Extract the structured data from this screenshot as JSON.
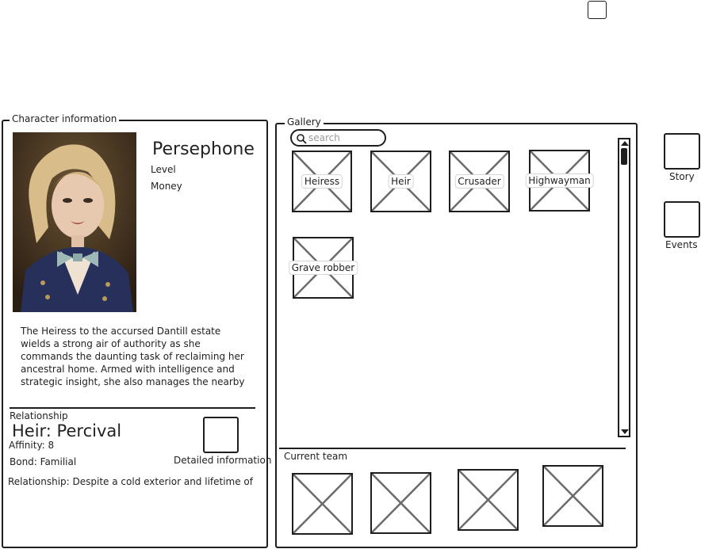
{
  "character_panel": {
    "legend": "Character information",
    "name": "Persephone",
    "level_label": "Level",
    "money_label": "Money",
    "description": "The Heiress to the accursed Dantill estate wields a strong air of authority as she commands the daunting task of reclaiming her ancestral home. Armed with intelligence and strategic insight, she also manages the nearby",
    "relationship_label": "Relationship",
    "heir_name": "Heir: Percival",
    "affinity": "Affinity: 8",
    "bond": "Bond: Familial",
    "detail_label": "Detailed information",
    "relationship_text": "Relationship: Despite a cold exterior and lifetime of"
  },
  "gallery": {
    "legend": "Gallery",
    "search_placeholder": "search",
    "items": [
      "Heiress",
      "Heir",
      "Crusader",
      "Highwayman",
      "Grave robber"
    ]
  },
  "team": {
    "label": "Current team"
  },
  "side_buttons": {
    "story": "Story",
    "events": "Events"
  }
}
